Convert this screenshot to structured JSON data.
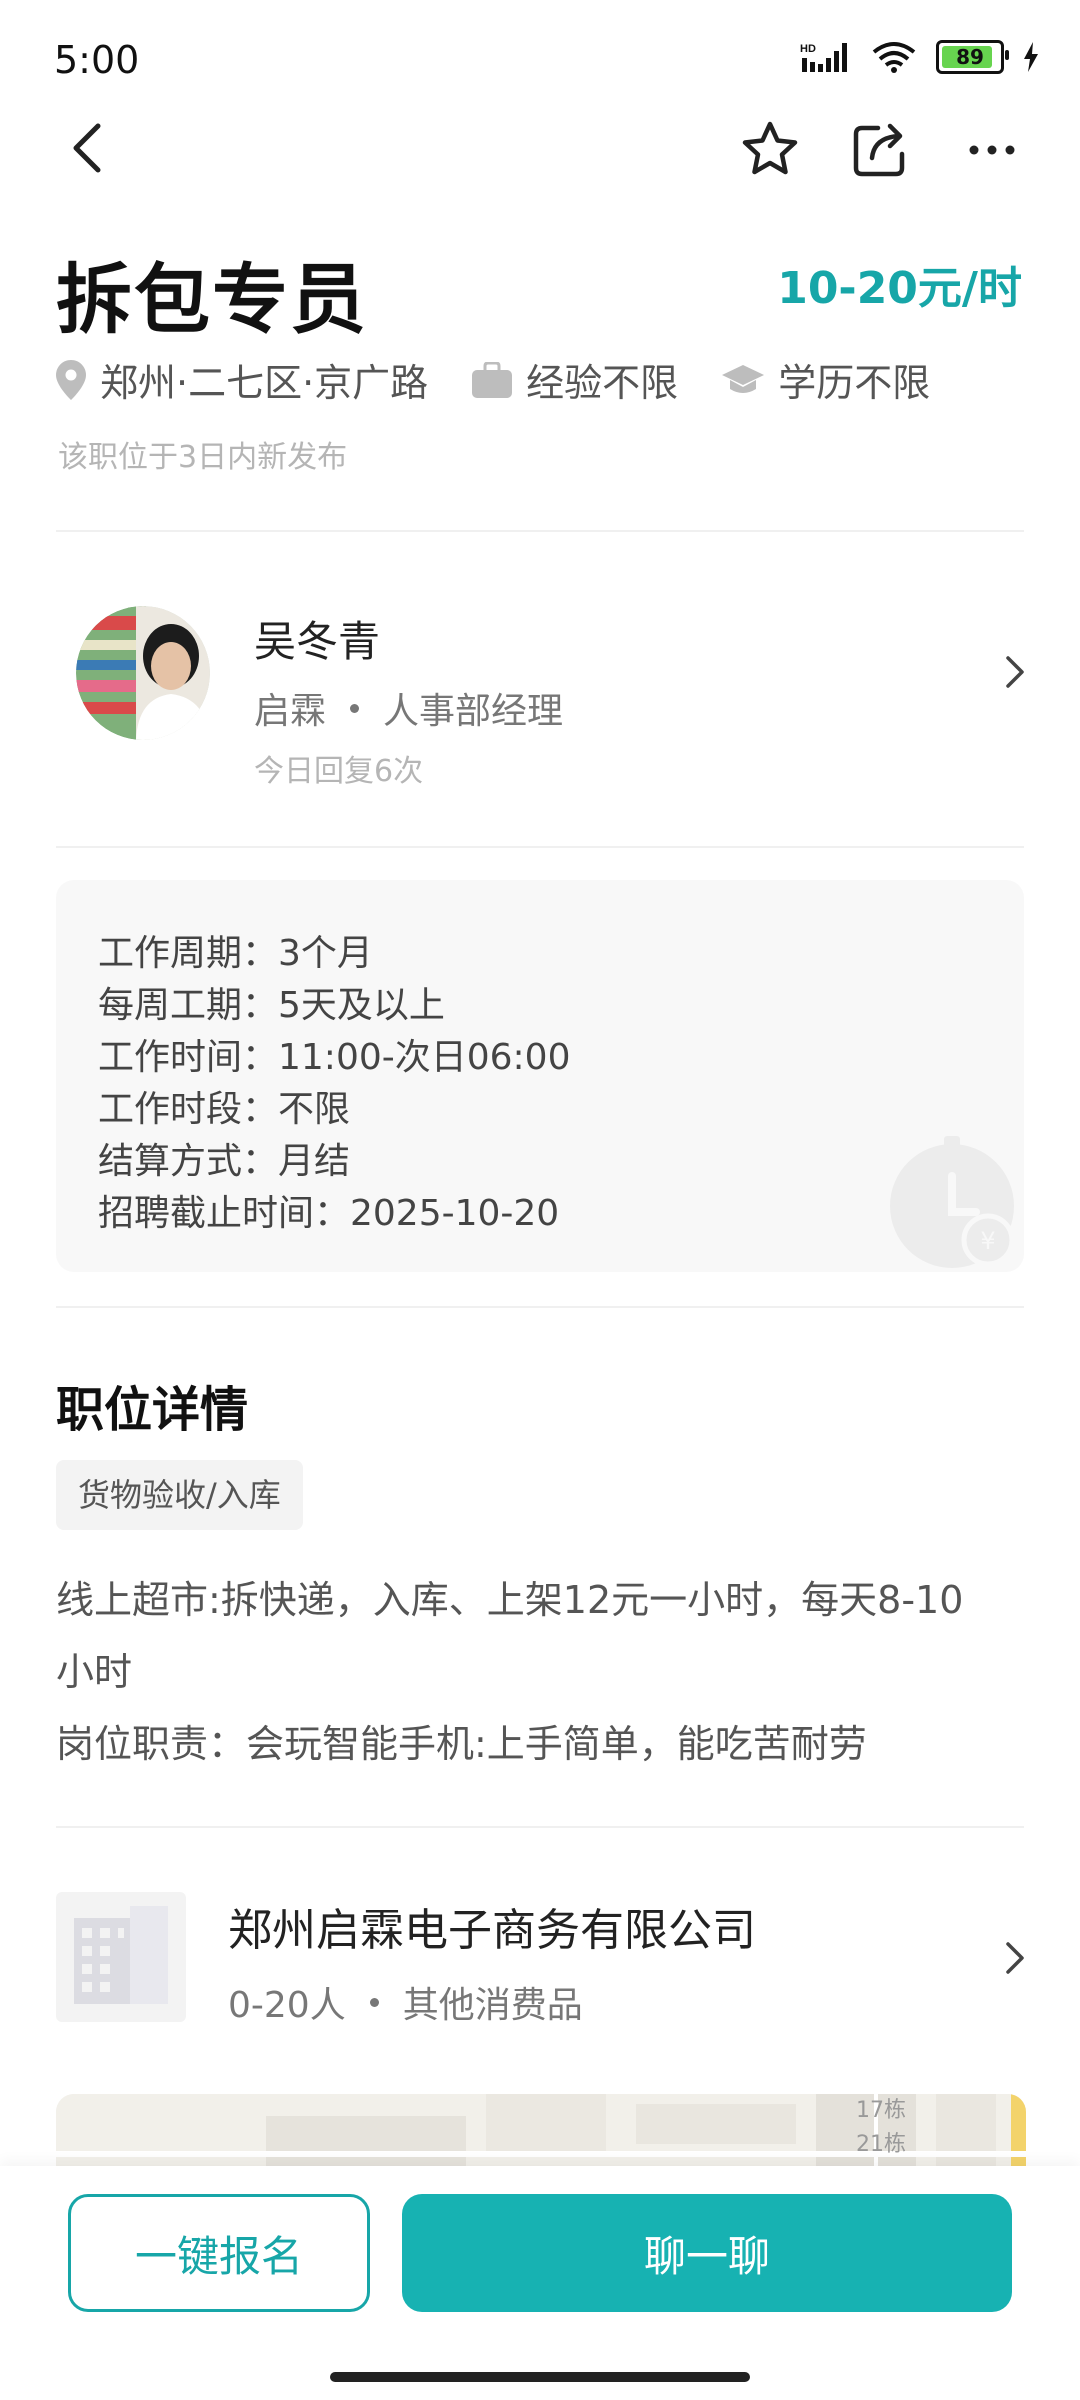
{
  "status_bar": {
    "time": "5:00",
    "battery": "89"
  },
  "job": {
    "title": "拆包专员",
    "salary": "10-20元/时",
    "location": "郑州·二七区·京广路",
    "experience": "经验不限",
    "education": "学历不限",
    "posted": "该职位于3日内新发布"
  },
  "recruiter": {
    "name": "吴冬青",
    "company_short": "启霖",
    "title": "人事部经理",
    "reply": "今日回复6次"
  },
  "info": [
    "工作周期：3个月",
    "每周工期：5天及以上",
    "工作时间：11:00-次日06:00",
    "工作时段：不限",
    "结算方式：月结",
    "招聘截止时间：2025-10-20"
  ],
  "details": {
    "heading": "职位详情",
    "tag": "货物验收/入库",
    "desc_line1": "线上超市:拆快递，入库、上架12元一小时，每天8-10",
    "desc_line2": "小时",
    "desc_line3": "岗位职责：会玩智能手机:上手简单，能吃苦耐劳"
  },
  "company": {
    "name": "郑州启霖电子商务有限公司",
    "size": "0-20人",
    "industry": "其他消费品"
  },
  "map": {
    "label1": "17栋",
    "label2": "21栋"
  },
  "actions": {
    "apply": "一键报名",
    "chat": "聊一聊"
  },
  "colors": {
    "accent": "#17a6a8",
    "button": "#17b2b2"
  }
}
